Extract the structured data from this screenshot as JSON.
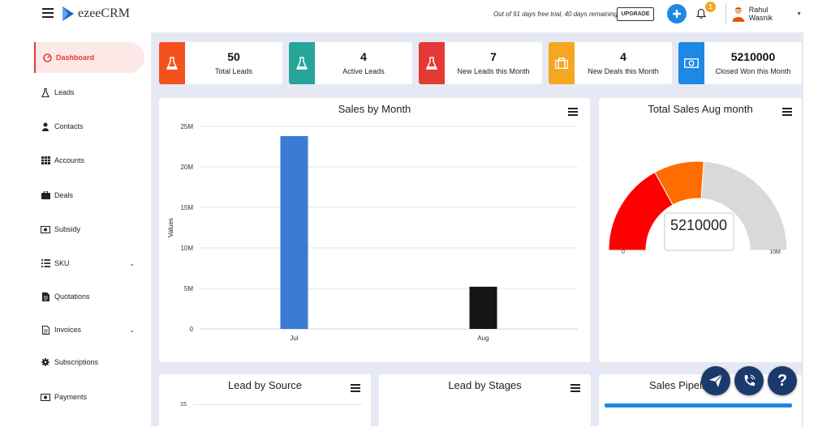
{
  "app": {
    "name": "ezeeCRM"
  },
  "header": {
    "trial_text": "Out of 91 days free trial, 40 days remaining",
    "upgrade_label": "UPGRADE",
    "notification_count": "1",
    "user_name": "Rahul Wasnik"
  },
  "sidebar": {
    "items": [
      {
        "label": "Dashboard",
        "icon": "dashboard-icon"
      },
      {
        "label": "Leads",
        "icon": "flask-icon"
      },
      {
        "label": "Contacts",
        "icon": "user-icon"
      },
      {
        "label": "Accounts",
        "icon": "table-icon"
      },
      {
        "label": "Deals",
        "icon": "briefcase-icon"
      },
      {
        "label": "Subsidy",
        "icon": "money-icon"
      },
      {
        "label": "SKU",
        "icon": "list-icon"
      },
      {
        "label": "Quotations",
        "icon": "file-icon"
      },
      {
        "label": "Invoices",
        "icon": "file-text-icon"
      },
      {
        "label": "Subscriptions",
        "icon": "gear-icon"
      },
      {
        "label": "Payments",
        "icon": "money-icon"
      }
    ]
  },
  "stats": [
    {
      "value": "50",
      "label": "Total Leads",
      "color": "#f4511e"
    },
    {
      "value": "4",
      "label": "Active Leads",
      "color": "#26a69a"
    },
    {
      "value": "7",
      "label": "New Leads this Month",
      "color": "#e53935"
    },
    {
      "value": "4",
      "label": "New Deals this Month",
      "color": "#f5a623"
    },
    {
      "value": "5210000",
      "label": "Closed Won this Month",
      "color": "#1e88e5"
    }
  ],
  "cards": {
    "sales_by_month": "Sales by Month",
    "total_sales": "Total Sales Aug month",
    "lead_by_source": "Lead by Source",
    "lead_by_stages": "Lead by Stages",
    "sales_pipeline": "Sales Pipeline"
  },
  "gauge": {
    "value_label": "5210000",
    "min_label": "0",
    "max_label": "10M",
    "value": 5210000,
    "min": 0,
    "max": 10000000
  },
  "chart_data": [
    {
      "type": "bar",
      "title": "Sales by Month",
      "categories": [
        "Jul",
        "Aug"
      ],
      "values": [
        23800000,
        5210000
      ],
      "colors": [
        "#3a7bd5",
        "#151515"
      ],
      "ylabel": "Values",
      "ylim": [
        0,
        25000000
      ],
      "yticks": [
        "0",
        "5M",
        "10M",
        "15M",
        "20M",
        "25M"
      ],
      "grid": true
    },
    {
      "type": "bar",
      "title": "Lead by Source",
      "yticks": [
        "15"
      ]
    }
  ]
}
